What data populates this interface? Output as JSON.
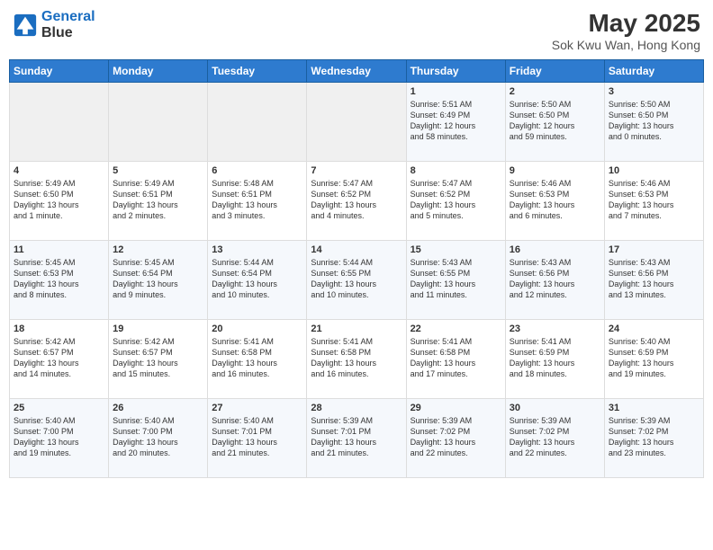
{
  "header": {
    "logo_line1": "General",
    "logo_line2": "Blue",
    "title": "May 2025",
    "subtitle": "Sok Kwu Wan, Hong Kong"
  },
  "weekdays": [
    "Sunday",
    "Monday",
    "Tuesday",
    "Wednesday",
    "Thursday",
    "Friday",
    "Saturday"
  ],
  "weeks": [
    [
      {
        "day": "",
        "info": ""
      },
      {
        "day": "",
        "info": ""
      },
      {
        "day": "",
        "info": ""
      },
      {
        "day": "",
        "info": ""
      },
      {
        "day": "1",
        "info": "Sunrise: 5:51 AM\nSunset: 6:49 PM\nDaylight: 12 hours\nand 58 minutes."
      },
      {
        "day": "2",
        "info": "Sunrise: 5:50 AM\nSunset: 6:50 PM\nDaylight: 12 hours\nand 59 minutes."
      },
      {
        "day": "3",
        "info": "Sunrise: 5:50 AM\nSunset: 6:50 PM\nDaylight: 13 hours\nand 0 minutes."
      }
    ],
    [
      {
        "day": "4",
        "info": "Sunrise: 5:49 AM\nSunset: 6:50 PM\nDaylight: 13 hours\nand 1 minute."
      },
      {
        "day": "5",
        "info": "Sunrise: 5:49 AM\nSunset: 6:51 PM\nDaylight: 13 hours\nand 2 minutes."
      },
      {
        "day": "6",
        "info": "Sunrise: 5:48 AM\nSunset: 6:51 PM\nDaylight: 13 hours\nand 3 minutes."
      },
      {
        "day": "7",
        "info": "Sunrise: 5:47 AM\nSunset: 6:52 PM\nDaylight: 13 hours\nand 4 minutes."
      },
      {
        "day": "8",
        "info": "Sunrise: 5:47 AM\nSunset: 6:52 PM\nDaylight: 13 hours\nand 5 minutes."
      },
      {
        "day": "9",
        "info": "Sunrise: 5:46 AM\nSunset: 6:53 PM\nDaylight: 13 hours\nand 6 minutes."
      },
      {
        "day": "10",
        "info": "Sunrise: 5:46 AM\nSunset: 6:53 PM\nDaylight: 13 hours\nand 7 minutes."
      }
    ],
    [
      {
        "day": "11",
        "info": "Sunrise: 5:45 AM\nSunset: 6:53 PM\nDaylight: 13 hours\nand 8 minutes."
      },
      {
        "day": "12",
        "info": "Sunrise: 5:45 AM\nSunset: 6:54 PM\nDaylight: 13 hours\nand 9 minutes."
      },
      {
        "day": "13",
        "info": "Sunrise: 5:44 AM\nSunset: 6:54 PM\nDaylight: 13 hours\nand 10 minutes."
      },
      {
        "day": "14",
        "info": "Sunrise: 5:44 AM\nSunset: 6:55 PM\nDaylight: 13 hours\nand 10 minutes."
      },
      {
        "day": "15",
        "info": "Sunrise: 5:43 AM\nSunset: 6:55 PM\nDaylight: 13 hours\nand 11 minutes."
      },
      {
        "day": "16",
        "info": "Sunrise: 5:43 AM\nSunset: 6:56 PM\nDaylight: 13 hours\nand 12 minutes."
      },
      {
        "day": "17",
        "info": "Sunrise: 5:43 AM\nSunset: 6:56 PM\nDaylight: 13 hours\nand 13 minutes."
      }
    ],
    [
      {
        "day": "18",
        "info": "Sunrise: 5:42 AM\nSunset: 6:57 PM\nDaylight: 13 hours\nand 14 minutes."
      },
      {
        "day": "19",
        "info": "Sunrise: 5:42 AM\nSunset: 6:57 PM\nDaylight: 13 hours\nand 15 minutes."
      },
      {
        "day": "20",
        "info": "Sunrise: 5:41 AM\nSunset: 6:58 PM\nDaylight: 13 hours\nand 16 minutes."
      },
      {
        "day": "21",
        "info": "Sunrise: 5:41 AM\nSunset: 6:58 PM\nDaylight: 13 hours\nand 16 minutes."
      },
      {
        "day": "22",
        "info": "Sunrise: 5:41 AM\nSunset: 6:58 PM\nDaylight: 13 hours\nand 17 minutes."
      },
      {
        "day": "23",
        "info": "Sunrise: 5:41 AM\nSunset: 6:59 PM\nDaylight: 13 hours\nand 18 minutes."
      },
      {
        "day": "24",
        "info": "Sunrise: 5:40 AM\nSunset: 6:59 PM\nDaylight: 13 hours\nand 19 minutes."
      }
    ],
    [
      {
        "day": "25",
        "info": "Sunrise: 5:40 AM\nSunset: 7:00 PM\nDaylight: 13 hours\nand 19 minutes."
      },
      {
        "day": "26",
        "info": "Sunrise: 5:40 AM\nSunset: 7:00 PM\nDaylight: 13 hours\nand 20 minutes."
      },
      {
        "day": "27",
        "info": "Sunrise: 5:40 AM\nSunset: 7:01 PM\nDaylight: 13 hours\nand 21 minutes."
      },
      {
        "day": "28",
        "info": "Sunrise: 5:39 AM\nSunset: 7:01 PM\nDaylight: 13 hours\nand 21 minutes."
      },
      {
        "day": "29",
        "info": "Sunrise: 5:39 AM\nSunset: 7:02 PM\nDaylight: 13 hours\nand 22 minutes."
      },
      {
        "day": "30",
        "info": "Sunrise: 5:39 AM\nSunset: 7:02 PM\nDaylight: 13 hours\nand 22 minutes."
      },
      {
        "day": "31",
        "info": "Sunrise: 5:39 AM\nSunset: 7:02 PM\nDaylight: 13 hours\nand 23 minutes."
      }
    ]
  ]
}
